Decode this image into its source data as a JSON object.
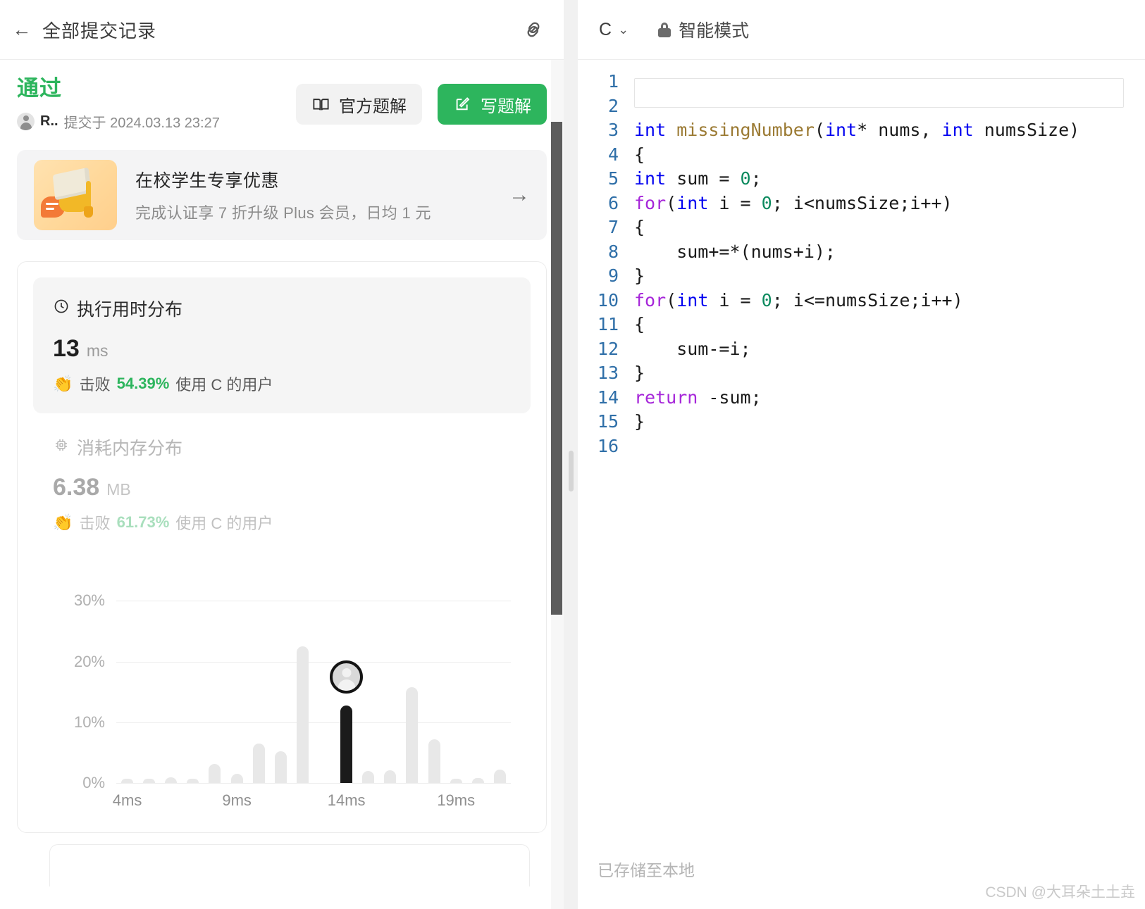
{
  "left": {
    "header": {
      "back_icon": "back-arrow-icon",
      "title": "全部提交记录",
      "link_icon": "link-icon"
    },
    "status": {
      "verdict": "通过",
      "submitter": "R..",
      "submitted_at": "提交于 2024.03.13 23:27"
    },
    "actions": {
      "official_solution": "官方题解",
      "write_solution": "写题解"
    },
    "banner": {
      "title": "在校学生专享优惠",
      "subtitle": "完成认证享 7 折升级 Plus 会员，日均 1 元",
      "arrow": "→"
    },
    "runtime": {
      "heading": "执行用时分布",
      "value": "13",
      "unit": "ms",
      "beat_prefix": "击败",
      "beat_pct": "54.39%",
      "beat_suffix": "使用 C 的用户"
    },
    "memory": {
      "heading": "消耗内存分布",
      "value": "6.38",
      "unit": "MB",
      "beat_prefix": "击败",
      "beat_pct": "61.73%",
      "beat_suffix": "使用 C 的用户"
    }
  },
  "chart_data": {
    "type": "bar",
    "title": "消耗内存分布",
    "xlabel": "",
    "ylabel": "",
    "ylim": [
      0,
      35
    ],
    "grid": true,
    "legend": false,
    "ytick_labels": [
      "30%",
      "20%",
      "10%",
      "0%"
    ],
    "ytick_values": [
      30,
      20,
      10,
      0
    ],
    "xtick_labels": [
      "4ms",
      "9ms",
      "14ms",
      "19ms"
    ],
    "xtick_indices": [
      0,
      5,
      10,
      15
    ],
    "highlight_index": 10,
    "highlight_color": "#1b1b1b",
    "bar_color": "#e8e8e8",
    "marker": {
      "index": 10,
      "value": 17.5,
      "icon": "user-avatar-marker"
    },
    "categories": [
      "4ms",
      "5ms",
      "6ms",
      "7ms",
      "8ms",
      "9ms",
      "10ms",
      "11ms",
      "12ms",
      "13ms",
      "14ms",
      "15ms",
      "16ms",
      "17ms",
      "18ms",
      "19ms",
      "20ms",
      "21ms"
    ],
    "values": [
      0.7,
      0.7,
      0.9,
      0.7,
      3.2,
      1.5,
      6.5,
      5.2,
      22.5,
      0,
      12.8,
      2.0,
      2.1,
      15.8,
      7.2,
      0.7,
      0.8,
      2.2
    ]
  },
  "right": {
    "language": "C",
    "caret_icon": "chevron-down-icon",
    "lock_icon": "lock-icon",
    "mode": "智能模式",
    "saved_status": "已存储至本地",
    "watermark": "CSDN @大耳朵土土垚",
    "code_lines": [
      {
        "n": "1",
        "tokens": []
      },
      {
        "n": "2",
        "tokens": []
      },
      {
        "n": "3",
        "tokens": [
          {
            "t": "int",
            "c": "tk-kw"
          },
          {
            "t": " ",
            "c": "tk-pl"
          },
          {
            "t": "missingNumber",
            "c": "tk-fn"
          },
          {
            "t": "(",
            "c": "tk-pl"
          },
          {
            "t": "int",
            "c": "tk-kw"
          },
          {
            "t": "* nums, ",
            "c": "tk-pl"
          },
          {
            "t": "int",
            "c": "tk-kw"
          },
          {
            "t": " numsSize)",
            "c": "tk-pl"
          }
        ]
      },
      {
        "n": "4",
        "tokens": [
          {
            "t": "{",
            "c": "tk-pl"
          }
        ]
      },
      {
        "n": "5",
        "tokens": [
          {
            "t": "int",
            "c": "tk-kw"
          },
          {
            "t": " sum = ",
            "c": "tk-pl"
          },
          {
            "t": "0",
            "c": "tk-num"
          },
          {
            "t": ";",
            "c": "tk-pl"
          }
        ]
      },
      {
        "n": "6",
        "tokens": [
          {
            "t": "for",
            "c": "tk-ctl"
          },
          {
            "t": "(",
            "c": "tk-pl"
          },
          {
            "t": "int",
            "c": "tk-kw"
          },
          {
            "t": " i = ",
            "c": "tk-pl"
          },
          {
            "t": "0",
            "c": "tk-num"
          },
          {
            "t": "; i<numsSize;i++)",
            "c": "tk-pl"
          }
        ]
      },
      {
        "n": "7",
        "tokens": [
          {
            "t": "{",
            "c": "tk-pl"
          }
        ]
      },
      {
        "n": "8",
        "tokens": [
          {
            "t": "    sum+=*(nums+i);",
            "c": "tk-pl"
          }
        ]
      },
      {
        "n": "9",
        "tokens": [
          {
            "t": "}",
            "c": "tk-pl"
          }
        ]
      },
      {
        "n": "10",
        "tokens": [
          {
            "t": "for",
            "c": "tk-ctl"
          },
          {
            "t": "(",
            "c": "tk-pl"
          },
          {
            "t": "int",
            "c": "tk-kw"
          },
          {
            "t": " i = ",
            "c": "tk-pl"
          },
          {
            "t": "0",
            "c": "tk-num"
          },
          {
            "t": "; i<=numsSize;i++)",
            "c": "tk-pl"
          }
        ]
      },
      {
        "n": "11",
        "tokens": [
          {
            "t": "{",
            "c": "tk-pl"
          }
        ]
      },
      {
        "n": "12",
        "tokens": [
          {
            "t": "    sum-=i;",
            "c": "tk-pl"
          }
        ]
      },
      {
        "n": "13",
        "tokens": [
          {
            "t": "}",
            "c": "tk-pl"
          }
        ]
      },
      {
        "n": "14",
        "tokens": [
          {
            "t": "return",
            "c": "tk-ctl"
          },
          {
            "t": " -sum;",
            "c": "tk-pl"
          }
        ]
      },
      {
        "n": "15",
        "tokens": [
          {
            "t": "}",
            "c": "tk-pl"
          }
        ]
      },
      {
        "n": "16",
        "tokens": []
      }
    ]
  }
}
